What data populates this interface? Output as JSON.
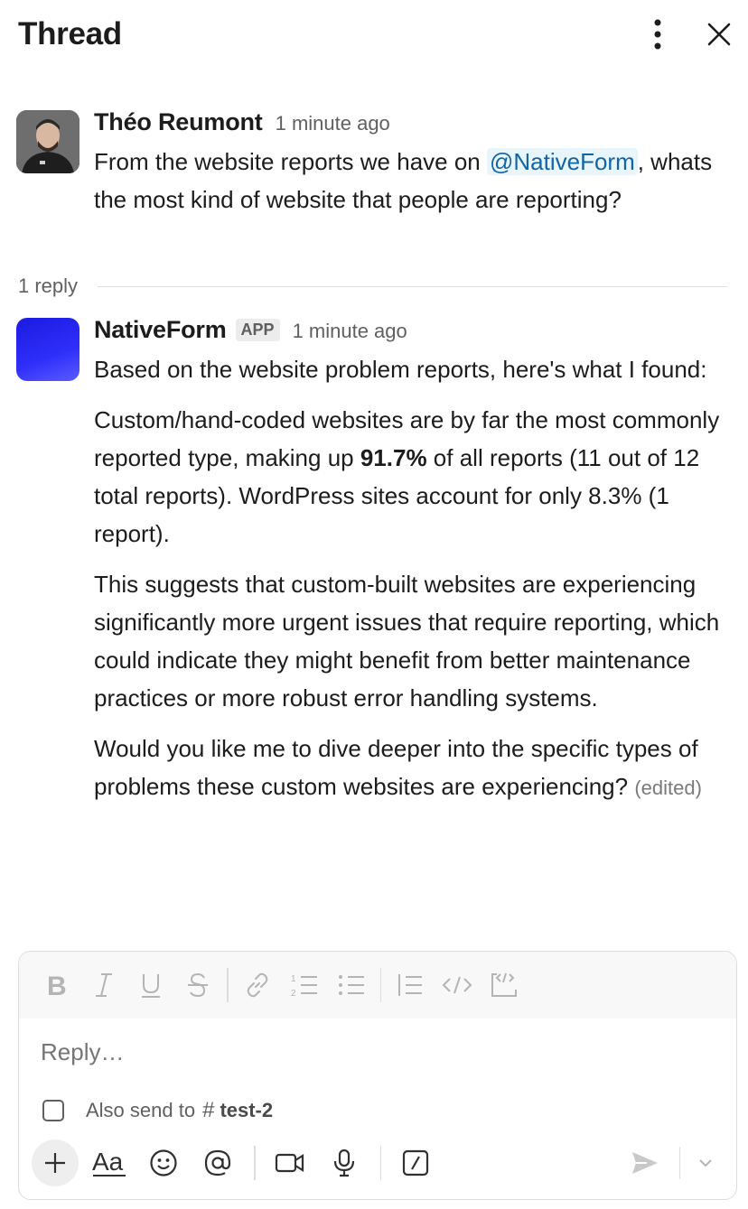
{
  "header": {
    "title": "Thread"
  },
  "icons": {
    "more": "more-vertical-icon",
    "close": "close-icon",
    "bold": "bold-icon",
    "italic": "italic-icon",
    "underline": "underline-icon",
    "strikethrough": "strikethrough-icon",
    "link": "link-icon",
    "ordered_list": "ordered-list-icon",
    "bullet_list": "bullet-list-icon",
    "blockquote": "blockquote-icon",
    "code": "code-icon",
    "code_block": "code-block-icon",
    "plus": "plus-icon",
    "format": "text-format-icon",
    "emoji": "emoji-icon",
    "mention": "mention-icon",
    "video": "video-icon",
    "mic": "microphone-icon",
    "shortcuts": "shortcuts-icon",
    "send": "send-icon",
    "chevron": "chevron-down-icon"
  },
  "colors": {
    "mention_text": "#1264a3",
    "mention_bg": "#e8f5fa",
    "app_avatar": "#2f2ffa"
  },
  "parent_message": {
    "author": "Théo Reumont",
    "time": "1 minute ago",
    "text_before": "From the website reports we have on ",
    "mention": "@NativeForm",
    "text_after": ", whats the most kind of website that people are reporting?"
  },
  "replies": {
    "count_label": "1 reply"
  },
  "reply_message": {
    "author": "NativeForm",
    "badge": "APP",
    "time": "1 minute ago",
    "p1": "Based on the website problem reports, here's what I found:",
    "p2_before": "Custom/hand-coded websites are by far the most commonly reported type, making up ",
    "p2_bold": "91.7%",
    "p2_after": " of all reports (11 out of 12 total reports). WordPress sites account for only 8.3% (1 report).",
    "p3": "This suggests that custom-built websites are experiencing significantly more urgent issues that require reporting, which could indicate they might benefit from better maintenance practices or more robust error handling systems.",
    "p4": "Would you like me to dive deeper into the specific types of problems these custom websites are experiencing?",
    "edited": "(edited)"
  },
  "composer": {
    "placeholder": "Reply…",
    "also_send_label": "Also send to",
    "channel_hash": "#",
    "channel_name": "test-2"
  }
}
